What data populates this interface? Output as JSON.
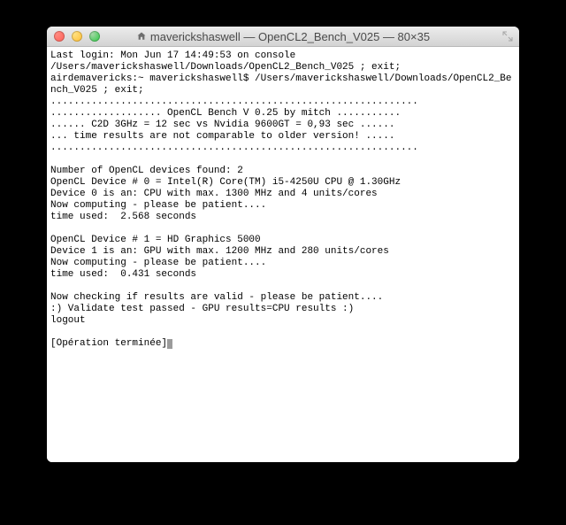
{
  "window": {
    "title": "maverickshaswell — OpenCL2_Bench_V025 — 80×35"
  },
  "terminal": {
    "lines": [
      "Last login: Mon Jun 17 14:49:53 on console",
      "/Users/maverickshaswell/Downloads/OpenCL2_Bench_V025 ; exit;",
      "airdemavericks:~ maverickshaswell$ /Users/maverickshaswell/Downloads/OpenCL2_Bench_V025 ; exit;",
      "...............................................................",
      "................... OpenCL Bench V 0.25 by mitch ...........",
      "...... C2D 3GHz = 12 sec vs Nvidia 9600GT = 0,93 sec ......",
      "... time results are not comparable to older version! .....",
      "...............................................................",
      "",
      "Number of OpenCL devices found: 2",
      "OpenCL Device # 0 = Intel(R) Core(TM) i5-4250U CPU @ 1.30GHz",
      "Device 0 is an: CPU with max. 1300 MHz and 4 units/cores",
      "Now computing - please be patient....",
      "time used:  2.568 seconds",
      "",
      "OpenCL Device # 1 = HD Graphics 5000",
      "Device 1 is an: GPU with max. 1200 MHz and 280 units/cores",
      "Now computing - please be patient....",
      "time used:  0.431 seconds",
      "",
      "Now checking if results are valid - please be patient....",
      ":) Validate test passed - GPU results=CPU results :)",
      "logout",
      "",
      "[Opération terminée]"
    ]
  }
}
